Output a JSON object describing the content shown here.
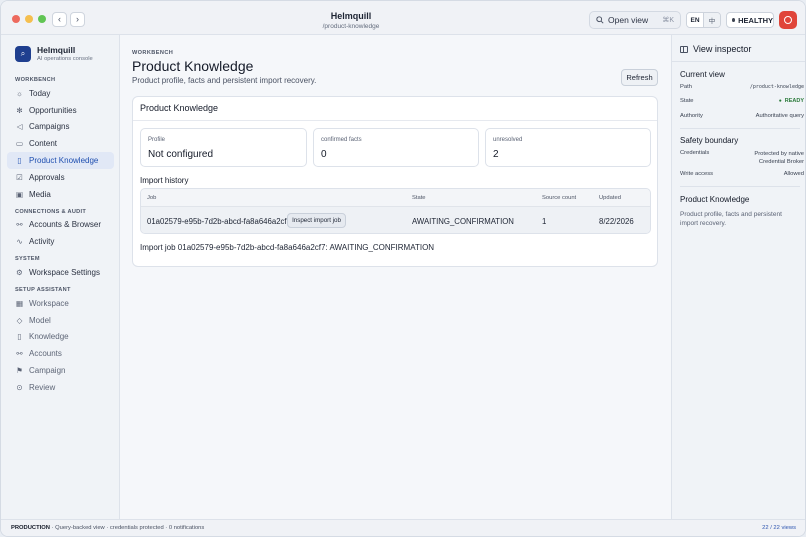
{
  "titlebar": {
    "title": "Helmquill",
    "path": "/product-knowledge",
    "open_view_label": "Open view",
    "open_view_shortcut": "⌘K",
    "lang_active": "EN",
    "lang_alt": "中",
    "health_label": "HEALTHY"
  },
  "brand": {
    "name": "Helmquill",
    "subtitle": "AI operations console"
  },
  "sidebar": {
    "sections": [
      {
        "label": "WORKBENCH",
        "items": [
          {
            "label": "Today",
            "icon": "sun-icon"
          },
          {
            "label": "Opportunities",
            "icon": "sparkle-icon"
          },
          {
            "label": "Campaigns",
            "icon": "megaphone-icon"
          },
          {
            "label": "Content",
            "icon": "document-icon"
          },
          {
            "label": "Product Knowledge",
            "icon": "book-icon"
          },
          {
            "label": "Approvals",
            "icon": "check-square-icon"
          },
          {
            "label": "Media",
            "icon": "image-icon"
          }
        ]
      },
      {
        "label": "CONNECTIONS & AUDIT",
        "items": [
          {
            "label": "Accounts & Browser",
            "icon": "link-icon"
          },
          {
            "label": "Activity",
            "icon": "pulse-icon"
          }
        ]
      },
      {
        "label": "SYSTEM",
        "items": [
          {
            "label": "Workspace Settings",
            "icon": "gear-icon"
          }
        ]
      },
      {
        "label": "SETUP ASSISTANT",
        "items": [
          {
            "label": "Workspace",
            "icon": "grid-icon"
          },
          {
            "label": "Model",
            "icon": "cube-icon"
          },
          {
            "label": "Knowledge",
            "icon": "book-icon"
          },
          {
            "label": "Accounts",
            "icon": "link-icon"
          },
          {
            "label": "Campaign",
            "icon": "flag-icon"
          },
          {
            "label": "Review",
            "icon": "check-circle-icon"
          }
        ]
      }
    ]
  },
  "main": {
    "eyebrow": "WORKBENCH",
    "title": "Product Knowledge",
    "subtitle": "Product profile, facts and persistent import recovery.",
    "refresh_label": "Refresh",
    "card_title": "Product Knowledge",
    "stats": [
      {
        "label": "Profile",
        "value": "Not configured"
      },
      {
        "label": "confirmed facts",
        "value": "0"
      },
      {
        "label": "unresolved",
        "value": "2"
      }
    ],
    "import_history_label": "Import history",
    "table": {
      "headers": [
        "Job",
        "State",
        "Source count",
        "Updated"
      ],
      "rows": [
        {
          "job": "01a02579-e95b-7d2b-abcd-fa8a646a2cf7",
          "action": "Inspect import job",
          "state": "AWAITING_CONFIRMATION",
          "source_count": "1",
          "updated": "8/22/2026"
        }
      ]
    },
    "status_line": "Import job 01a02579-e95b-7d2b-abcd-fa8a646a2cf7: AWAITING_CONFIRMATION"
  },
  "inspector": {
    "title": "View inspector",
    "current_view_label": "Current view",
    "path_key": "Path",
    "path_value": "/product-knowledge",
    "state_key": "State",
    "state_value": "READY",
    "authority_key": "Authority",
    "authority_value": "Authoritative query",
    "safety_label": "Safety boundary",
    "credentials_key": "Credentials",
    "credentials_value": "Protected by native Credential Broker",
    "write_key": "Write access",
    "write_value": "Allowed",
    "section_title": "Product Knowledge",
    "section_desc": "Product profile, facts and persistent import recovery."
  },
  "footer": {
    "env": "PRODUCTION",
    "info": " · Query-backed view · credentials protected · 0 notifications",
    "views": "22 / 22 views"
  },
  "colors": {
    "accent": "#1f4fb0",
    "danger": "#e0453a",
    "ready": "#2a7a3a"
  }
}
